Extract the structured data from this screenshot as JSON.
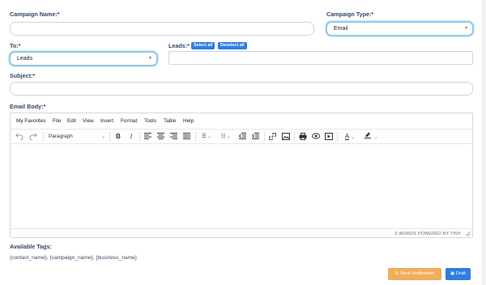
{
  "form": {
    "campaign_name_label": "Campaign Name:*",
    "campaign_name_value": "",
    "campaign_type_label": "Campaign Type:*",
    "campaign_type_value": "Email",
    "to_label": "To:*",
    "to_value": "Leads",
    "leads_label": "Leads:*",
    "select_all": "Select all",
    "deselect_all": "Deselect all",
    "subject_label": "Subject:*",
    "email_body_label": "Email Body:*"
  },
  "editor": {
    "menu": [
      "My Favorites",
      "File",
      "Edit",
      "View",
      "Insert",
      "Format",
      "Tools",
      "Table",
      "Help"
    ],
    "block_format": "Paragraph",
    "status": "0 WORDS  POWERED BY TINY"
  },
  "tags": {
    "title": "Available Tags:",
    "list": "{contact_name}, {campaign_name}, {business_name}"
  },
  "actions": {
    "send": "Send Notification",
    "draft": "Draft"
  },
  "colors": {
    "primary": "#2f7de1",
    "warning": "#f0ad5a",
    "label": "#34456b"
  }
}
